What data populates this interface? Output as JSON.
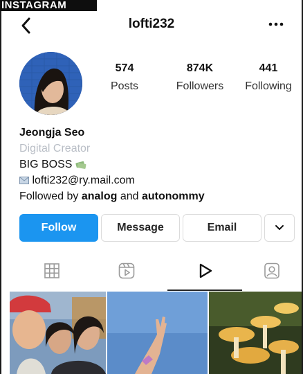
{
  "banner_text": "INSTAGRAM",
  "header": {
    "username": "lofti232",
    "back_icon": "chevron-left-icon",
    "more_icon": "more-horizontal-icon"
  },
  "stats": {
    "posts": {
      "value": "574",
      "label": "Posts"
    },
    "followers": {
      "value": "874K",
      "label": "Followers"
    },
    "following": {
      "value": "441",
      "label": "Following"
    }
  },
  "bio": {
    "name": "Jeongja Seo",
    "category": "Digital Creator",
    "line1": "BIG BOSS",
    "email": "lofti232@ry.mail.com",
    "followed_by_prefix": "Followed by ",
    "followed_by_user1": "analog",
    "followed_by_and": " and ",
    "followed_by_user2": "autonommy"
  },
  "buttons": {
    "follow": "Follow",
    "message": "Message",
    "email": "Email"
  },
  "tabs": [
    "grid-icon",
    "reels-icon",
    "play-icon",
    "tagged-icon"
  ],
  "colors": {
    "follow_bg": "#1b95f0",
    "category": "#b9bec6"
  }
}
